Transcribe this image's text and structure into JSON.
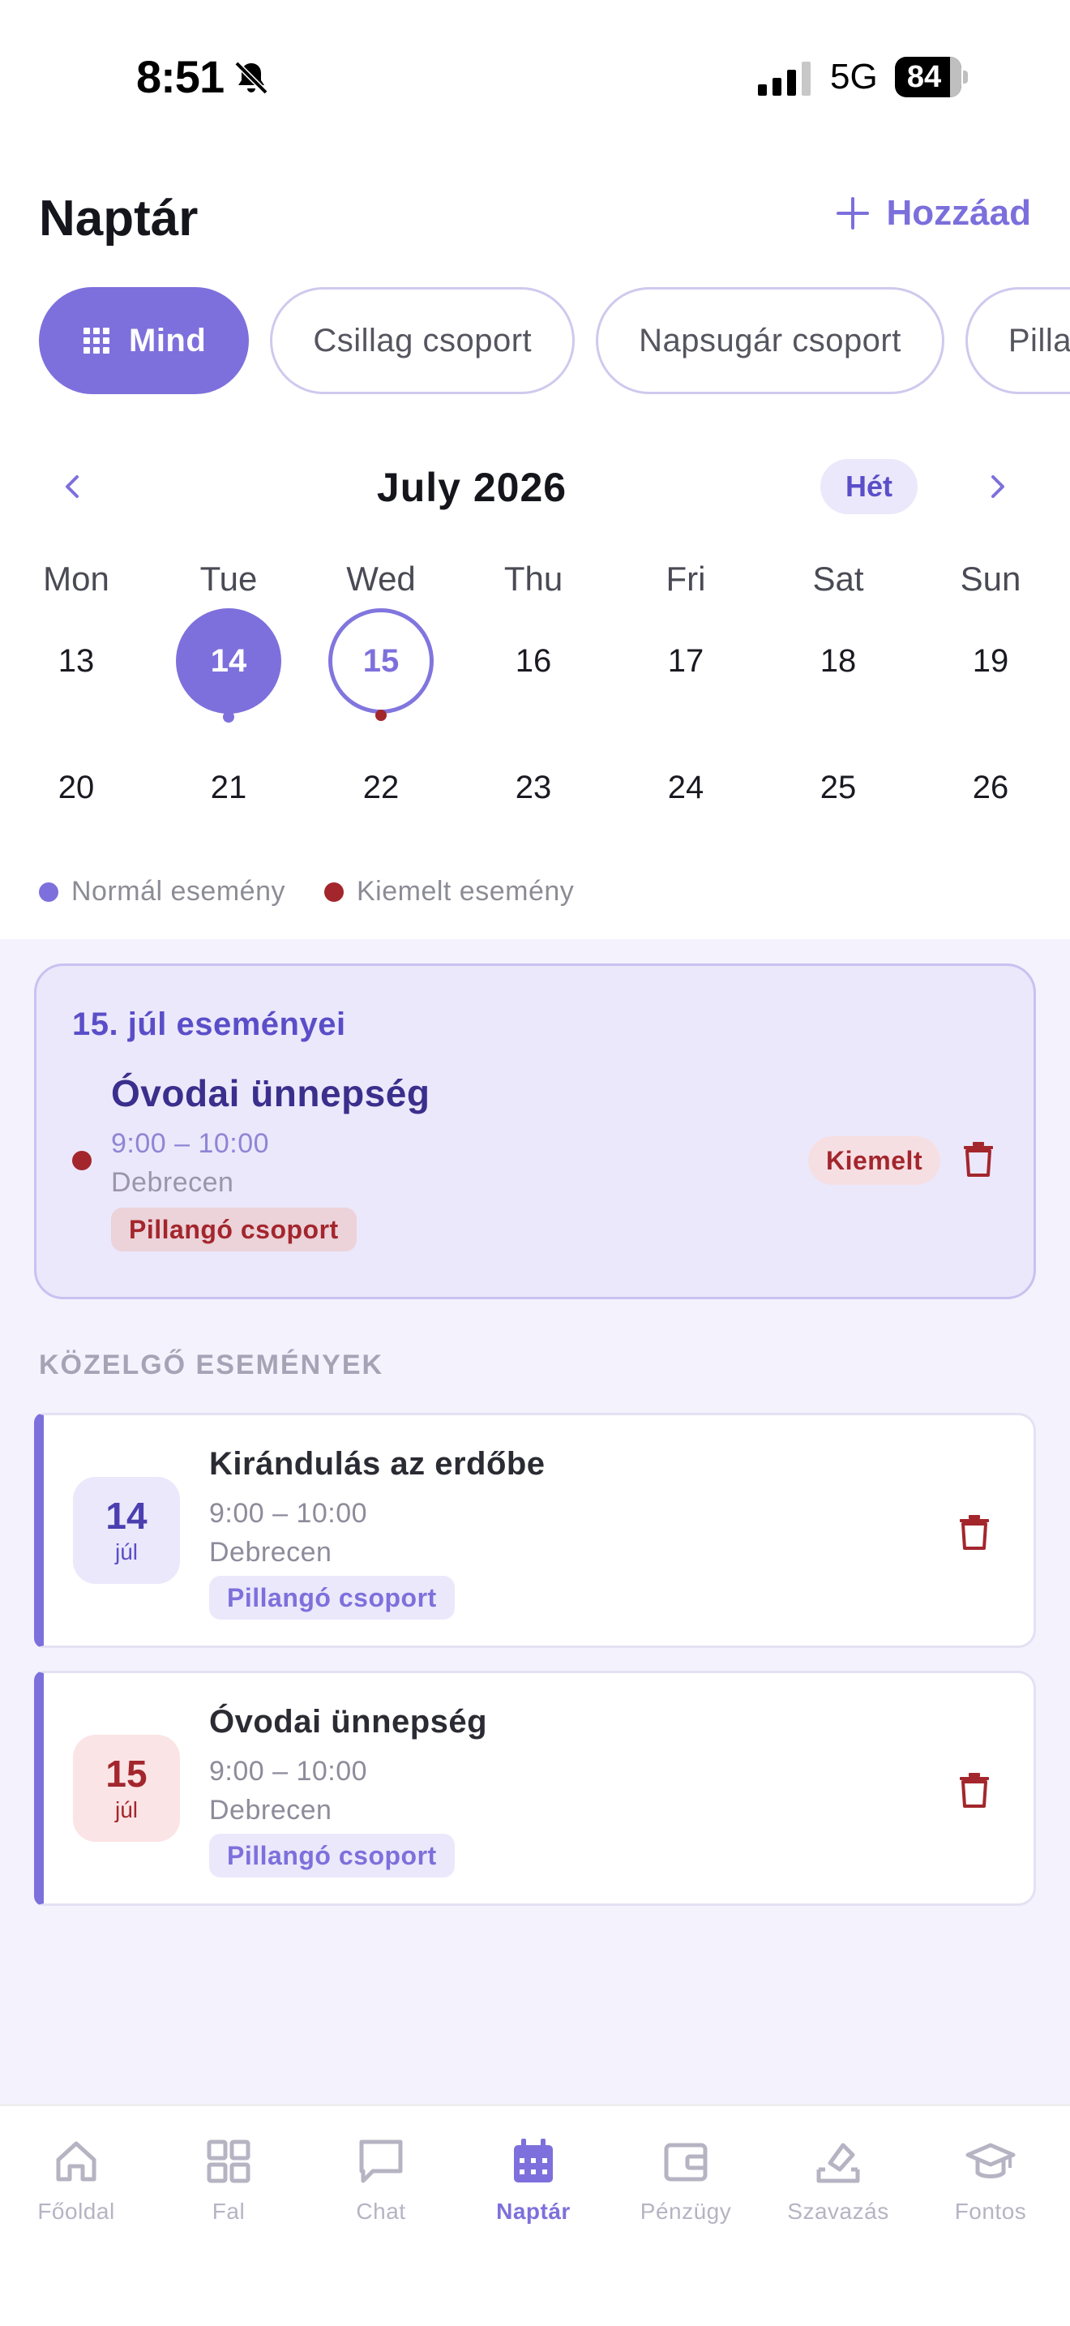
{
  "status_bar": {
    "time": "8:51",
    "network": "5G",
    "battery": "84"
  },
  "header": {
    "title": "Naptár",
    "add_label": "Hozzáad"
  },
  "filters": [
    {
      "label": "Mind",
      "active": true
    },
    {
      "label": "Csillag csoport",
      "active": false
    },
    {
      "label": "Napsugár csoport",
      "active": false
    },
    {
      "label": "Pillangó csoport",
      "active": false
    }
  ],
  "calendar": {
    "month_title": "July 2026",
    "view_toggle": "Hét",
    "weekdays": [
      "Mon",
      "Tue",
      "Wed",
      "Thu",
      "Fri",
      "Sat",
      "Sun"
    ],
    "weeks": [
      [
        "13",
        "14",
        "15",
        "16",
        "17",
        "18",
        "19"
      ],
      [
        "20",
        "21",
        "22",
        "23",
        "24",
        "25",
        "26"
      ]
    ],
    "today": "14",
    "selected": "15"
  },
  "legend": {
    "normal": "Normál esemény",
    "highlighted": "Kiemelt esemény"
  },
  "colors": {
    "accent": "#7d70dc",
    "highlight": "#a3262d",
    "section_bg": "#f4f2fd"
  },
  "selected_day": {
    "title": "15. júl eseményei",
    "event": {
      "title": "Óvodai ünnepség",
      "time": "9:00 – 10:00",
      "place": "Debrecen",
      "group": "Pillangó csoport",
      "badge": "Kiemelt"
    }
  },
  "upcoming": {
    "label": "KÖZELGŐ ESEMÉNYEK",
    "events": [
      {
        "day": "14",
        "month": "júl",
        "title": "Kirándulás az erdőbe",
        "time": "9:00 – 10:00",
        "place": "Debrecen",
        "group": "Pillangó csoport",
        "highlighted": false
      },
      {
        "day": "15",
        "month": "júl",
        "title": "Óvodai ünnepség",
        "time": "9:00 – 10:00",
        "place": "Debrecen",
        "group": "Pillangó csoport",
        "highlighted": true
      }
    ]
  },
  "tabs": [
    {
      "label": "Főoldal",
      "icon": "home-icon"
    },
    {
      "label": "Fal",
      "icon": "grid-icon"
    },
    {
      "label": "Chat",
      "icon": "chat-icon"
    },
    {
      "label": "Naptár",
      "icon": "calendar-icon",
      "active": true
    },
    {
      "label": "Pénzügy",
      "icon": "wallet-icon"
    },
    {
      "label": "Szavazás",
      "icon": "vote-icon"
    },
    {
      "label": "Fontos",
      "icon": "graduation-cap-icon"
    }
  ]
}
